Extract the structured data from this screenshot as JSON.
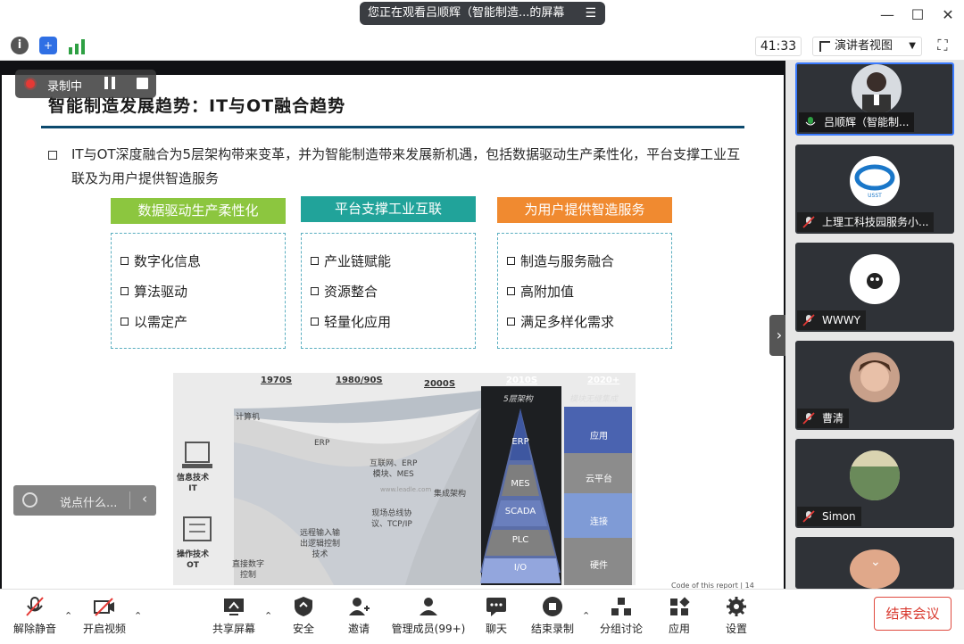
{
  "window": {
    "sharing_banner": "您正在观看吕顺辉（智能制造...的屏幕",
    "banner_menu_icon": "list-icon"
  },
  "toolbar": {
    "timer": "41:33",
    "view_mode": "演讲者视图",
    "signal_color": "#2ea043",
    "shield_color": "#2f6fe4"
  },
  "recording": {
    "label": "录制中"
  },
  "chat": {
    "placeholder": "说点什么..."
  },
  "slide": {
    "title": "智能制造发展趋势：IT与OT融合趋势",
    "bullet": "IT与OT深度融合为5层架构带来变革，并为智能制造带来发展新机遇，包括数据驱动生产柔性化，平台支撑工业互联及为用户提供智造服务",
    "columns": [
      {
        "title": "数据驱动生产柔性化",
        "color": "#8cc63f",
        "items": [
          "数字化信息",
          "算法驱动",
          "以需定产"
        ]
      },
      {
        "title": "平台支撑工业互联",
        "color": "#21a39a",
        "items": [
          "产业链赋能",
          "资源整合",
          "轻量化应用"
        ]
      },
      {
        "title": "为用户提供智造服务",
        "color": "#f08a30",
        "items": [
          "制造与服务融合",
          "高附加值",
          "满足多样化需求"
        ]
      }
    ],
    "footer": "Code of this report  | 14",
    "diagram": {
      "eras": [
        "1970S",
        "1980/90S",
        "2000S",
        "2010S",
        "2020+"
      ],
      "era_notes": [
        "5层架构",
        "模块无缝集成"
      ],
      "row_labels": [
        "信息技术\nIT",
        "操作技术\nOT"
      ],
      "stages": [
        "计算机",
        "ERP",
        "互联网、ERP\n模块、MES",
        "集成架构",
        "现场总线协\n议、TCP/IP",
        "远程输入输\n出逻辑控制\n技术",
        "直接数字\n控制"
      ],
      "watermark": "www.leadle.com",
      "pyramid": [
        "ERP",
        "MES",
        "SCADA",
        "PLC",
        "I/O"
      ],
      "modules": [
        "应用",
        "云平台",
        "连接",
        "硬件"
      ]
    }
  },
  "participants": [
    {
      "name": "吕顺辉（智能制...",
      "active": true
    },
    {
      "name": "上理工科技园服务小..."
    },
    {
      "name": "WWWY"
    },
    {
      "name": "曹清"
    },
    {
      "name": "Simon"
    },
    {
      "name": ""
    }
  ],
  "controls": {
    "unmute": "解除静音",
    "start_video": "开启视频",
    "share_screen": "共享屏幕",
    "security": "安全",
    "invite": "邀请",
    "manage_members": "管理成员(99+)",
    "chat": "聊天",
    "end_recording": "结束录制",
    "breakout": "分组讨论",
    "apps": "应用",
    "settings": "设置",
    "end_meeting": "结束会议"
  }
}
